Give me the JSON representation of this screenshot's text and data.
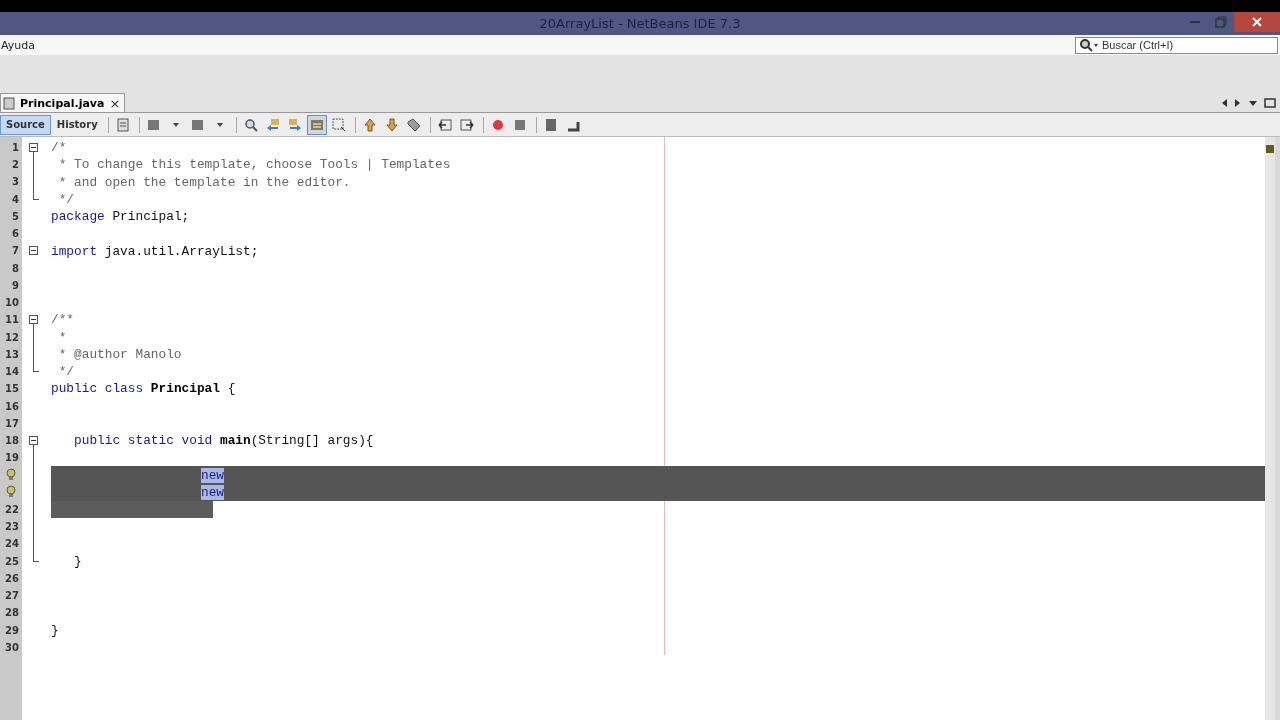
{
  "window": {
    "title": "20ArrayList - NetBeans IDE 7.3"
  },
  "menu": [
    "Ayuda"
  ],
  "search": {
    "placeholder": "Buscar (Ctrl+I)"
  },
  "file_tabs": [
    {
      "label": "Principal.java",
      "selected": true,
      "close": "×"
    }
  ],
  "view_tabs": [
    {
      "label": "Source",
      "selected": true
    },
    {
      "label": "History",
      "selected": false
    }
  ],
  "lines": [
    {
      "number": "1",
      "kind": "foldstart",
      "selected": false,
      "segments": [
        {
          "text": "/*",
          "kind": "comment"
        }
      ]
    },
    {
      "number": "2",
      "kind": "foldbody",
      "selected": false,
      "segments": [
        {
          "text": " * To change this template, choose Tools | Templates",
          "kind": "comment"
        }
      ]
    },
    {
      "number": "3",
      "kind": "foldbody",
      "selected": false,
      "segments": [
        {
          "text": " * and open the template in the editor.",
          "kind": "comment"
        }
      ]
    },
    {
      "number": "4",
      "kind": "foldend",
      "selected": false,
      "segments": [
        {
          "text": " */",
          "kind": "comment"
        }
      ]
    },
    {
      "number": "5",
      "kind": "plain",
      "selected": false,
      "segments": [
        {
          "text": "package",
          "kind": "keyword"
        },
        {
          "text": " Principal;",
          "kind": "plain"
        }
      ]
    },
    {
      "number": "6",
      "kind": "plain",
      "selected": false
    },
    {
      "number": "7",
      "kind": "foldsingle",
      "selected": false,
      "segments": [
        {
          "text": "import",
          "kind": "keyword"
        },
        {
          "text": " java.util.ArrayList;",
          "kind": "plain"
        }
      ]
    },
    {
      "number": "8",
      "kind": "plain",
      "selected": false
    },
    {
      "number": "9",
      "kind": "plain",
      "selected": false
    },
    {
      "number": "10",
      "kind": "plain",
      "selected": false
    },
    {
      "number": "11",
      "kind": "foldstart",
      "selected": false,
      "segments": [
        {
          "text": "/**",
          "kind": "comment"
        }
      ]
    },
    {
      "number": "12",
      "kind": "foldbody",
      "selected": false,
      "segments": [
        {
          "text": " *",
          "kind": "comment"
        }
      ]
    },
    {
      "number": "13",
      "kind": "foldbody",
      "selected": false,
      "segments": [
        {
          "text": " * @author Manolo",
          "kind": "comment"
        }
      ]
    },
    {
      "number": "14",
      "kind": "foldend",
      "selected": false,
      "segments": [
        {
          "text": " */",
          "kind": "comment"
        }
      ]
    },
    {
      "number": "15",
      "kind": "plain",
      "selected": false,
      "segments": [
        {
          "text": "public class ",
          "kind": "keyword"
        },
        {
          "text": "Principal",
          "kind": "bold"
        },
        {
          "text": " {",
          "kind": "plain"
        }
      ]
    },
    {
      "number": "16",
      "kind": "plain",
      "selected": false
    },
    {
      "number": "17",
      "kind": "plain",
      "selected": false
    },
    {
      "number": "18",
      "kind": "foldstart",
      "selected": false,
      "segments": [
        {
          "text": "   public static void ",
          "kind": "keyword"
        },
        {
          "text": "main",
          "kind": "bold"
        },
        {
          "text": "(String[] args){",
          "kind": "plain"
        }
      ]
    },
    {
      "number": "19",
      "kind": "foldbody",
      "selected": false
    },
    {
      "hint": true,
      "kind": "foldbody",
      "selected": true,
      "full_width": true,
      "segments": [
        {
          "text": "new",
          "kind": "keyword"
        }
      ]
    },
    {
      "hint": true,
      "kind": "foldbody",
      "selected": true,
      "full_width": true,
      "segments": [
        {
          "text": "new",
          "kind": "keyword"
        }
      ]
    },
    {
      "number": "22",
      "kind": "foldbody",
      "selected": true,
      "full_width": false
    },
    {
      "number": "23",
      "kind": "foldbody",
      "selected": false
    },
    {
      "number": "24",
      "kind": "foldbody",
      "selected": false
    },
    {
      "number": "25",
      "kind": "foldend",
      "selected": false,
      "segments": [
        {
          "text": "   }",
          "kind": "plain"
        }
      ]
    },
    {
      "number": "26",
      "kind": "plain",
      "selected": false
    },
    {
      "number": "27",
      "kind": "plain",
      "selected": false
    },
    {
      "number": "28",
      "kind": "plain",
      "selected": false
    },
    {
      "number": "29",
      "kind": "plain",
      "selected": false,
      "segments": [
        {
          "text": "}",
          "kind": "plain"
        }
      ]
    },
    {
      "number": "30",
      "kind": "plain",
      "selected": false
    }
  ]
}
